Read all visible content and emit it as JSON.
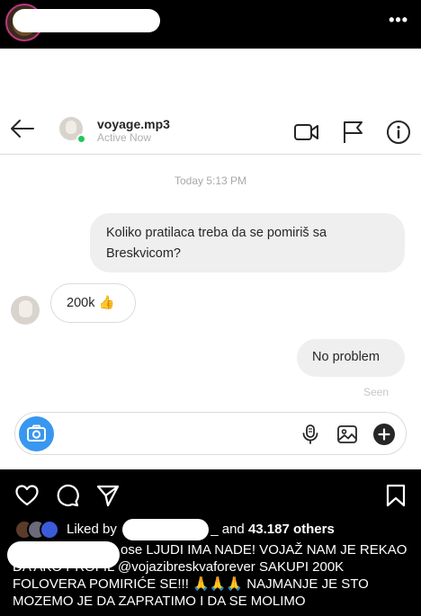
{
  "post_header": {
    "more_icon": "more-horizontal-icon"
  },
  "chat": {
    "contact_name": "voyage.mp3",
    "contact_status": "Active Now",
    "timestamp": "Today 5:13 PM",
    "messages": [
      {
        "direction": "outgoing",
        "text": "Koliko pratilaca treba da se pomiriš sa Breskvicom?"
      },
      {
        "direction": "incoming",
        "text": "200k 👍"
      },
      {
        "direction": "outgoing",
        "text": "No problem"
      }
    ],
    "seen_label": "Seen",
    "header_icons": [
      "back-arrow-icon",
      "video-call-icon",
      "flag-icon",
      "info-icon"
    ],
    "composer_icons": [
      "camera-icon",
      "microphone-icon",
      "image-icon",
      "plus-icon"
    ],
    "colors": {
      "camera_button": "#3897f0",
      "online_dot": "#22c55e"
    }
  },
  "post_footer": {
    "liked_by_prefix": "Liked by",
    "liked_by_suffix": "_ and",
    "others_count": "43.187 others",
    "caption_line1": "ose LJUDI IMA NADE! VOJAŽ NAM JE REKAO",
    "caption_line2_prefix": "DA AKO PROFIL",
    "caption_tag": "@vojazibreskvaforever",
    "caption_line2_suffix": "SAKUPI 200K",
    "caption_line3": "FOLOVERA POMIRIĆE SE!!! 🙏🙏🙏 NAJMANJE JE STO",
    "caption_line4": "MOZEMO JE DA ZAPRATIMO I DA SE MOLIMO",
    "action_icons": [
      "heart-icon",
      "comment-icon",
      "share-icon",
      "bookmark-icon"
    ]
  }
}
